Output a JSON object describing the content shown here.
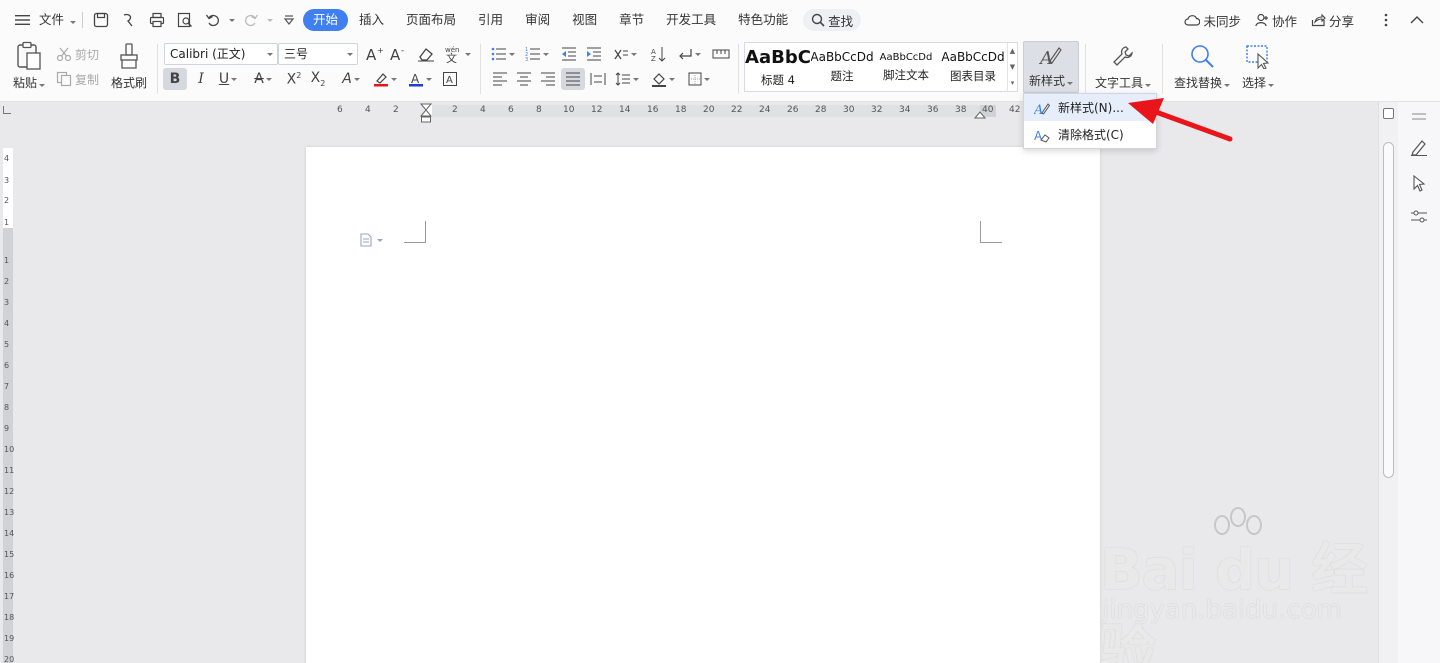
{
  "menubar": {
    "file_label": "文件",
    "tabs": [
      {
        "label": "开始",
        "active": true
      },
      {
        "label": "插入",
        "active": false
      },
      {
        "label": "页面布局",
        "active": false
      },
      {
        "label": "引用",
        "active": false
      },
      {
        "label": "审阅",
        "active": false
      },
      {
        "label": "视图",
        "active": false
      },
      {
        "label": "章节",
        "active": false
      },
      {
        "label": "开发工具",
        "active": false
      },
      {
        "label": "特色功能",
        "active": false
      }
    ],
    "search_label": "查找",
    "sync_label": "未同步",
    "collab_label": "协作",
    "share_label": "分享"
  },
  "ribbon": {
    "paste_label": "粘贴",
    "cut_label": "剪切",
    "copy_label": "复制",
    "format_painter_label": "格式刷",
    "font_name": "Calibri (正文)",
    "font_size": "三号",
    "styles": [
      {
        "sample": "AaBbC",
        "name": "标题 4"
      },
      {
        "sample": "AaBbCcDd",
        "name": "题注"
      },
      {
        "sample": "AaBbCcDd",
        "name": "脚注文本"
      },
      {
        "sample": "AaBbCcDd",
        "name": "图表目录"
      }
    ],
    "new_style_label": "新样式",
    "text_tools_label": "文字工具",
    "find_replace_label": "查找替换",
    "select_label": "选择"
  },
  "dropdown": {
    "items": [
      {
        "label": "新样式(N)..."
      },
      {
        "label": "清除格式(C)"
      }
    ]
  },
  "ruler": {
    "h_ticks": [
      "6",
      "4",
      "2",
      "2",
      "4",
      "6",
      "8",
      "10",
      "12",
      "14",
      "16",
      "18",
      "20",
      "22",
      "24",
      "26",
      "28",
      "30",
      "32",
      "34",
      "36",
      "38",
      "40",
      "42"
    ],
    "v_ticks_top": [
      "4",
      "3",
      "2",
      "1"
    ],
    "v_ticks": [
      "1",
      "2",
      "3",
      "4",
      "5",
      "6",
      "7",
      "8",
      "9",
      "10",
      "11",
      "12",
      "13",
      "14",
      "15",
      "16",
      "17",
      "18",
      "19",
      "20"
    ]
  },
  "watermark": {
    "brand": "Bai du 经验",
    "url": "jingyan.baidu.com"
  },
  "colors": {
    "accent": "#3f7ff0",
    "annotation_arrow": "#e8161b"
  }
}
